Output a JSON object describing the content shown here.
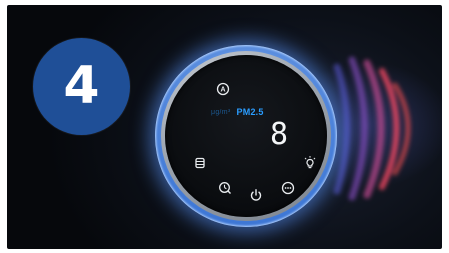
{
  "step": {
    "number": "4"
  },
  "display": {
    "unit_label": "μg/m³",
    "metric_label": "PM2.5",
    "reading": "8"
  },
  "icons": {
    "auto_mode": "auto-mode-icon",
    "filter": "filter-icon",
    "light": "light-icon",
    "timer": "timer-icon",
    "power": "power-icon",
    "speed": "fan-speed-icon"
  },
  "colors": {
    "badge": "#1f4f97",
    "ring_glow": "#3f78d6",
    "pm_label": "#2a9dff",
    "wave_inner": "#6a4fd8",
    "wave_outer": "#ff4a55"
  }
}
